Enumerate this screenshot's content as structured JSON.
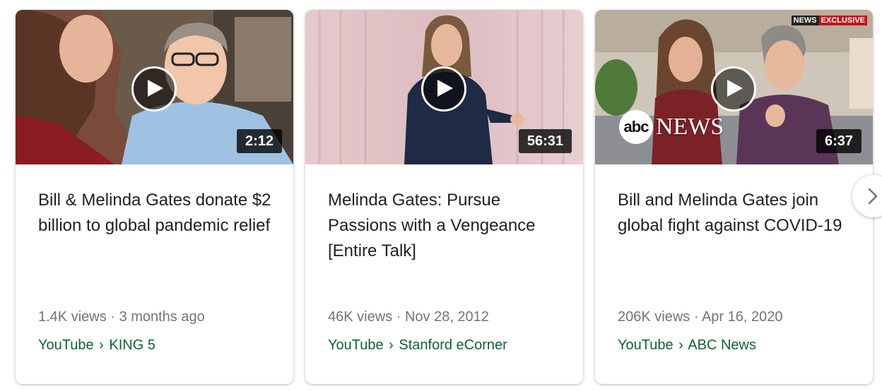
{
  "cards": [
    {
      "duration": "2:12",
      "title": "Bill & Melinda Gates donate $2 billion to global pandemic relief",
      "views": "1.4K views",
      "date": "3 months ago",
      "platform": "YouTube",
      "channel": "KING 5"
    },
    {
      "duration": "56:31",
      "title": "Melinda Gates: Pursue Passions with a Vengeance [Entire Talk]",
      "views": "46K views",
      "date": "Nov 28, 2012",
      "platform": "YouTube",
      "channel": "Stanford eCorner"
    },
    {
      "duration": "6:37",
      "title": "Bill and Melinda Gates join global fight against COVID-19",
      "views": "206K views",
      "date": "Apr 16, 2020",
      "platform": "YouTube",
      "channel": "ABC News",
      "overlay_logo": {
        "abc": "abc",
        "news": "NEWS"
      },
      "overlay_badge": {
        "news": "NEWS",
        "exclusive": "EXCLUSIVE"
      }
    }
  ],
  "separators": {
    "meta": "·",
    "source": "›"
  },
  "icons": {
    "play": "play-icon",
    "next": "chevron-right-icon"
  },
  "colors": {
    "source_green": "#0d652d",
    "meta_gray": "#70757a",
    "title": "#202124"
  }
}
